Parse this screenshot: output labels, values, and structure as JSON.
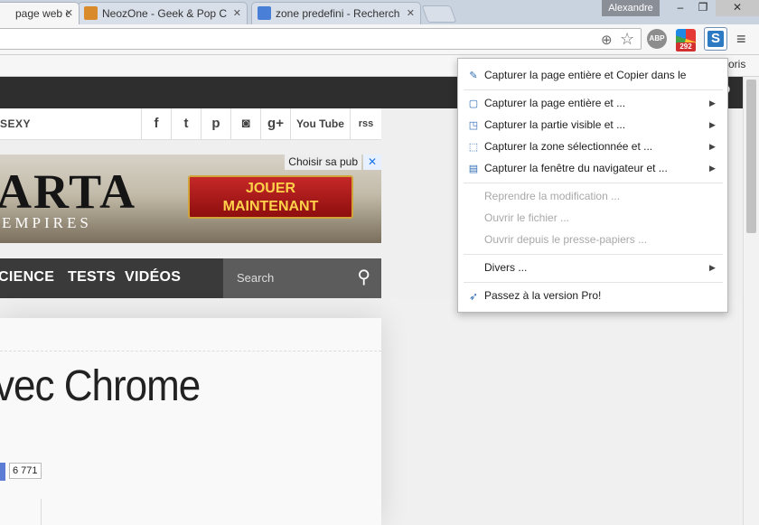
{
  "tabs": [
    {
      "title": "page web c",
      "active": true
    },
    {
      "title": "NeozOne - Geek & Pop C",
      "active": false
    },
    {
      "title": "zone predefini - Recherch",
      "active": false
    }
  ],
  "user_badge": "Alexandre",
  "window_controls": {
    "minimize": "–",
    "maximize": "❐",
    "close": "✕"
  },
  "toolbar": {
    "ext_abp": "ABP",
    "ext_badge_count": "292",
    "ext_s": "S",
    "menu": "≡"
  },
  "bookmarks": {
    "label": "voris"
  },
  "page": {
    "sexy_label": "SEXY",
    "social": [
      "f",
      "t",
      "p",
      "◙",
      "g+",
      "You Tube",
      "rss"
    ],
    "ad": {
      "choose_label": "Choisir sa pub",
      "close": "✕",
      "brand": "ARTA",
      "brand_sub": "EMPIRES",
      "cta_line1": "JOUER",
      "cta_line2": "MAINTENANT"
    },
    "nav": [
      "CIENCE",
      "TESTS",
      "VIDÉOS"
    ],
    "search_placeholder": "Search",
    "article_title": "vec Chrome",
    "share_count": "6 771"
  },
  "dropdown": {
    "items": [
      {
        "label": "Capturer la page entière et Copier dans le",
        "icon": "pen-icon",
        "disabled": false,
        "submenu": false
      },
      {
        "label": "Capturer la page entière et ...",
        "icon": "page-icon",
        "disabled": false,
        "submenu": true
      },
      {
        "label": "Capturer la partie visible et ...",
        "icon": "visible-icon",
        "disabled": false,
        "submenu": true
      },
      {
        "label": "Capturer la zone sélectionnée et ...",
        "icon": "selection-icon",
        "disabled": false,
        "submenu": true
      },
      {
        "label": "Capturer la fenêtre du navigateur et ...",
        "icon": "window-icon",
        "disabled": false,
        "submenu": true
      },
      {
        "label": "Reprendre la modification ...",
        "icon": "",
        "disabled": true,
        "submenu": false
      },
      {
        "label": "Ouvrir le fichier ...",
        "icon": "",
        "disabled": true,
        "submenu": false
      },
      {
        "label": "Ouvrir depuis le presse-papiers ...",
        "icon": "",
        "disabled": true,
        "submenu": false
      },
      {
        "label": "Divers ...",
        "icon": "",
        "disabled": false,
        "submenu": true
      },
      {
        "label": "Passez à la version Pro!",
        "icon": "rocket-icon",
        "disabled": false,
        "submenu": false
      }
    ],
    "submenu_arrow": "▶"
  },
  "colors": {
    "accent": "#2d6bb3",
    "disabled_text": "#a8a8a8"
  }
}
